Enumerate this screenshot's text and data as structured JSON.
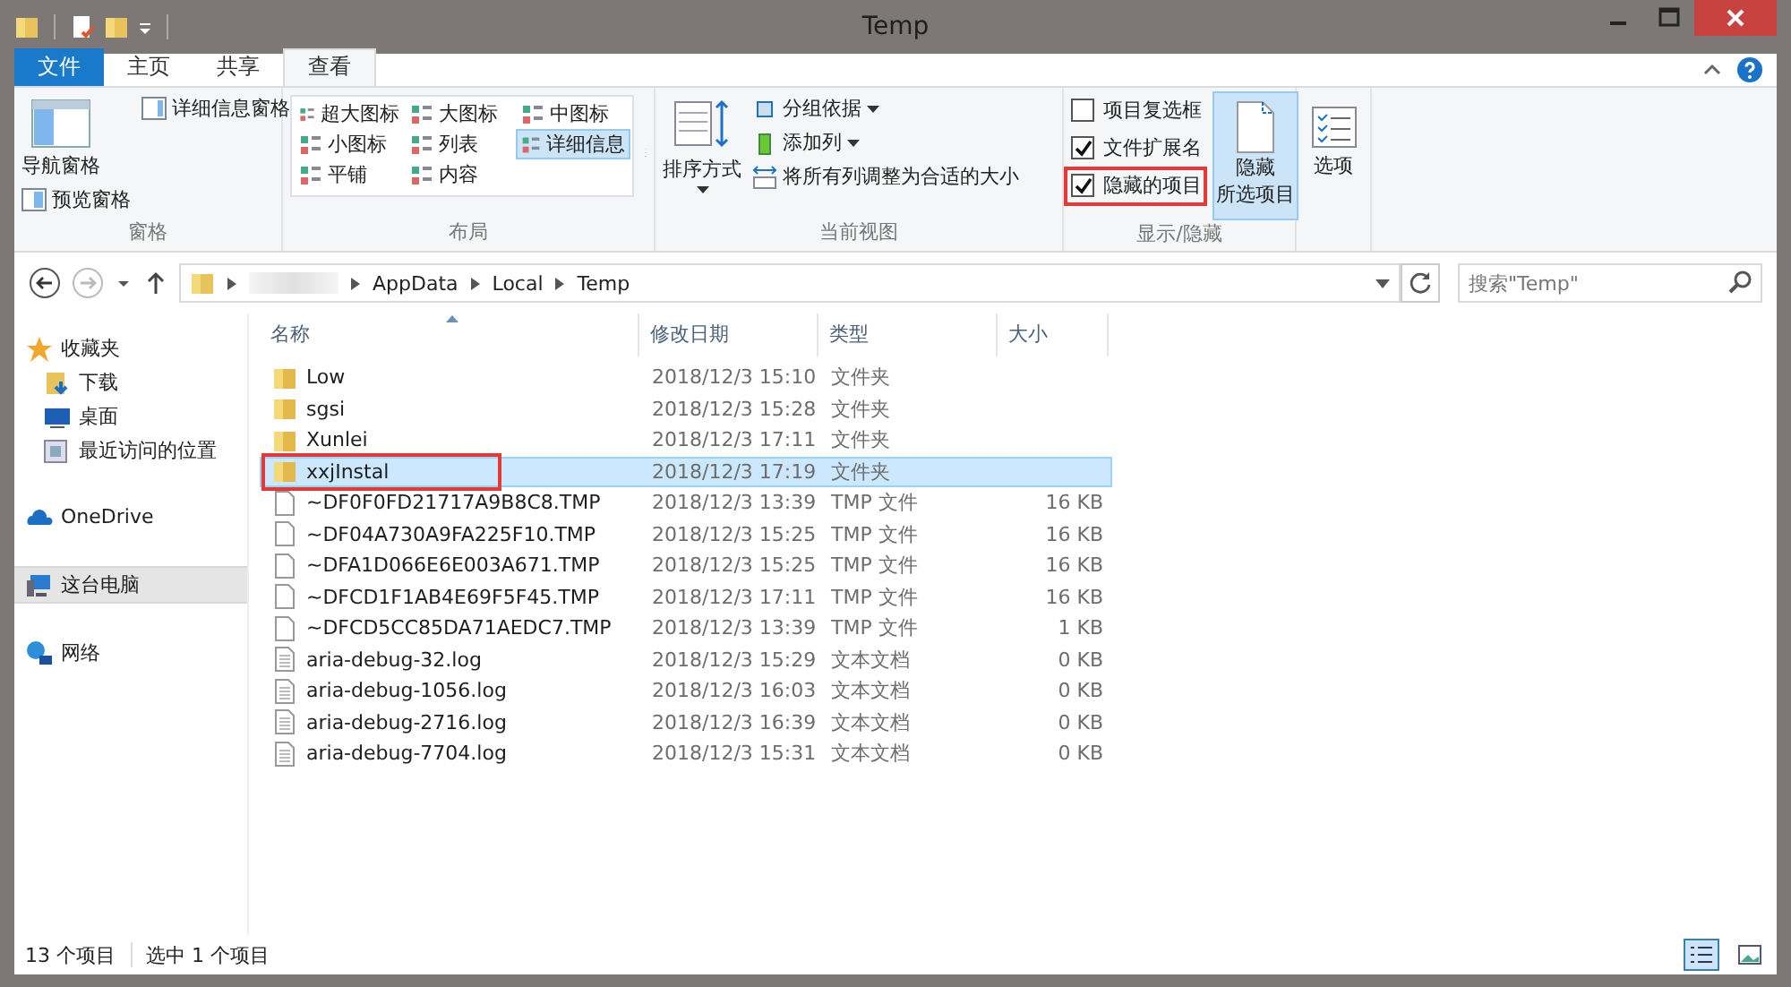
{
  "window": {
    "title": "Temp"
  },
  "ribbon_tabs": [
    {
      "label": "文件",
      "kind": "file",
      "selected": false
    },
    {
      "label": "主页",
      "kind": "tab",
      "selected": false
    },
    {
      "label": "共享",
      "kind": "tab",
      "selected": false
    },
    {
      "label": "查看",
      "kind": "tab",
      "selected": true
    }
  ],
  "panes_group": {
    "nav_pane": "导航窗格",
    "preview_pane": "预览窗格",
    "details_pane": "详细信息窗格",
    "label": "窗格"
  },
  "layout_group": {
    "label": "布局",
    "items": [
      {
        "label": "超大图标",
        "selected": false
      },
      {
        "label": "大图标",
        "selected": false
      },
      {
        "label": "中图标",
        "selected": false
      },
      {
        "label": "小图标",
        "selected": false
      },
      {
        "label": "列表",
        "selected": false
      },
      {
        "label": "详细信息",
        "selected": true
      },
      {
        "label": "平铺",
        "selected": false
      },
      {
        "label": "内容",
        "selected": false
      }
    ]
  },
  "view_group": {
    "label": "当前视图",
    "sort": "排序方式",
    "group_by": "分组依据",
    "add_column": "添加列",
    "fit_columns": "将所有列调整为合适的大小"
  },
  "show_hide_group": {
    "label": "显示/隐藏",
    "checkboxes": [
      {
        "label": "项目复选框",
        "checked": false,
        "highlighted": false
      },
      {
        "label": "文件扩展名",
        "checked": true,
        "highlighted": false
      },
      {
        "label": "隐藏的项目",
        "checked": true,
        "highlighted": true
      }
    ],
    "hide_selected": [
      "隐藏",
      "所选项目"
    ]
  },
  "options": "选项",
  "address": {
    "path": [
      "AppData",
      "Local",
      "Temp"
    ],
    "search_placeholder": "搜索\"Temp\""
  },
  "sidebar": [
    {
      "label": "收藏夹",
      "selected": false,
      "children": [
        {
          "label": "下载",
          "selected": false
        },
        {
          "label": "桌面",
          "selected": false
        },
        {
          "label": "最近访问的位置",
          "selected": false
        }
      ]
    },
    {
      "label": "OneDrive",
      "selected": false
    },
    {
      "label": "这台电脑",
      "selected": true
    },
    {
      "label": "网络",
      "selected": false
    }
  ],
  "columns": [
    "名称",
    "修改日期",
    "类型",
    "大小"
  ],
  "rows": [
    {
      "name": "Low",
      "date": "2018/12/3 15:10",
      "type": "文件夹",
      "kind": "folder",
      "selected": false,
      "highlighted": false
    },
    {
      "name": "sgsi",
      "date": "2018/12/3 15:28",
      "type": "文件夹",
      "kind": "folder",
      "selected": false,
      "highlighted": false
    },
    {
      "name": "Xunlei",
      "date": "2018/12/3 17:11",
      "type": "文件夹",
      "kind": "folder",
      "selected": false,
      "highlighted": false
    },
    {
      "name": "xxjInstal",
      "date": "2018/12/3 17:19",
      "type": "文件夹",
      "kind": "folder",
      "selected": true,
      "highlighted": true
    },
    {
      "name": "~DF0F0FD21717A9B8C8.TMP",
      "date": "2018/12/3 13:39",
      "type": "TMP 文件",
      "size": "16 KB",
      "kind": "file",
      "selected": false,
      "highlighted": false
    },
    {
      "name": "~DF04A730A9FA225F10.TMP",
      "date": "2018/12/3 15:25",
      "type": "TMP 文件",
      "size": "16 KB",
      "kind": "file",
      "selected": false,
      "highlighted": false
    },
    {
      "name": "~DFA1D066E6E003A671.TMP",
      "date": "2018/12/3 15:25",
      "type": "TMP 文件",
      "size": "16 KB",
      "kind": "file",
      "selected": false,
      "highlighted": false
    },
    {
      "name": "~DFCD1F1AB4E69F5F45.TMP",
      "date": "2018/12/3 17:11",
      "type": "TMP 文件",
      "size": "16 KB",
      "kind": "file",
      "selected": false,
      "highlighted": false
    },
    {
      "name": "~DFCD5CC85DA71AEDC7.TMP",
      "date": "2018/12/3 13:39",
      "type": "TMP 文件",
      "size": "1 KB",
      "kind": "file",
      "selected": false,
      "highlighted": false
    },
    {
      "name": "aria-debug-32.log",
      "date": "2018/12/3 15:29",
      "type": "文本文档",
      "size": "0 KB",
      "kind": "text",
      "selected": false,
      "highlighted": false
    },
    {
      "name": "aria-debug-1056.log",
      "date": "2018/12/3 16:03",
      "type": "文本文档",
      "size": "0 KB",
      "kind": "text",
      "selected": false,
      "highlighted": false
    },
    {
      "name": "aria-debug-2716.log",
      "date": "2018/12/3 16:39",
      "type": "文本文档",
      "size": "0 KB",
      "kind": "text",
      "selected": false,
      "highlighted": false
    },
    {
      "name": "aria-debug-7704.log",
      "date": "2018/12/3 15:31",
      "type": "文本文档",
      "size": "0 KB",
      "kind": "text",
      "selected": false,
      "highlighted": false
    }
  ],
  "status_bar": {
    "count": "13 个项目",
    "selection": "选中 1 个项目"
  }
}
